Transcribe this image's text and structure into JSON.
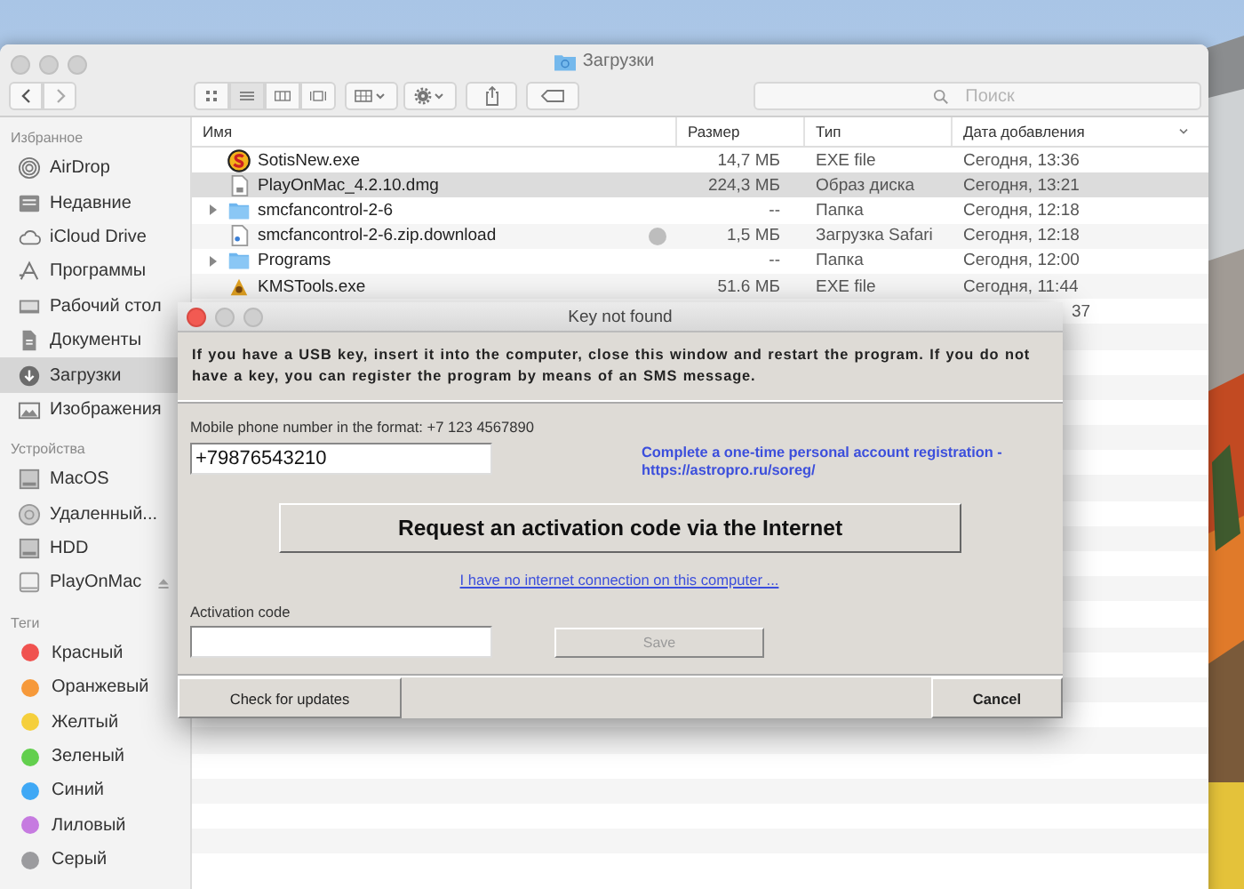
{
  "finder": {
    "title": "Загрузки",
    "search": {
      "placeholder": "Поиск"
    },
    "sidebar": [
      {
        "heading": "Избранное",
        "items": [
          {
            "label": "AirDrop",
            "selected": false
          },
          {
            "label": "Недавние",
            "selected": false
          },
          {
            "label": "iCloud Drive",
            "selected": false
          },
          {
            "label": "Программы",
            "selected": false
          },
          {
            "label": "Рабочий стол",
            "selected": false
          },
          {
            "label": "Документы",
            "selected": false
          },
          {
            "label": "Загрузки",
            "selected": true
          },
          {
            "label": "Изображения",
            "selected": false
          }
        ]
      },
      {
        "heading": "Устройства",
        "items": [
          {
            "label": "MacOS",
            "selected": false,
            "eject": false
          },
          {
            "label": "Удаленный...",
            "selected": false,
            "eject": false
          },
          {
            "label": "HDD",
            "selected": false,
            "eject": false
          },
          {
            "label": "PlayOnMac",
            "selected": false,
            "eject": true
          }
        ]
      }
    ],
    "tags_heading": "Теги",
    "tags": [
      {
        "label": "Красный",
        "color": "#f0524f"
      },
      {
        "label": "Оранжевый",
        "color": "#f6993a"
      },
      {
        "label": "Желтый",
        "color": "#f5cf3c"
      },
      {
        "label": "Зеленый",
        "color": "#62cf4d"
      },
      {
        "label": "Синий",
        "color": "#3fa8f5"
      },
      {
        "label": "Лиловый",
        "color": "#c67be0"
      },
      {
        "label": "Серый",
        "color": "#9b9b9e"
      }
    ],
    "columns": [
      "Имя",
      "Размер",
      "Тип",
      "Дата добавления"
    ],
    "files": [
      {
        "kind": "exe-s",
        "name": "SotisNew.exe",
        "size": "14,7 МБ",
        "type": "EXE file",
        "date": "Сегодня, 13:36",
        "selected": false
      },
      {
        "kind": "dmg",
        "name": "PlayOnMac_4.2.10.dmg",
        "size": "224,3 МБ",
        "type": "Образ диска",
        "date": "Сегодня, 13:21",
        "selected": true
      },
      {
        "kind": "folder",
        "name": "smcfancontrol-2-6",
        "size": "--",
        "type": "Папка",
        "date": "Сегодня, 12:18",
        "selected": false
      },
      {
        "kind": "download",
        "name": "smcfancontrol-2-6.zip.download",
        "size": "1,5 МБ",
        "type": "Загрузка Safari",
        "date": "Сегодня, 12:18",
        "selected": false
      },
      {
        "kind": "folder",
        "name": "Programs",
        "size": "--",
        "type": "Папка",
        "date": "Сегодня, 12:00",
        "selected": false
      },
      {
        "kind": "exe-k",
        "name": "KMSTools.exe",
        "size": "51.6 МБ",
        "type": "EXE file",
        "date": "Сегодня, 11:44",
        "selected": false
      },
      {
        "kind": "cut",
        "date": "37",
        "selected": false
      }
    ]
  },
  "dialog": {
    "title": "Key not found",
    "message": "If you have a USB key, insert it into the computer, close this window and restart the program. If you do not have a key, you can register the program by means of an SMS message.",
    "phone_label": "Mobile phone number in the format: +7 123 4567890",
    "phone_value": "+79876543210",
    "registration_link": "Complete a one-time personal account registration - https://astropro.ru/soreg/",
    "request_button": "Request an activation code via the Internet",
    "no_internet_link": "I have no internet connection on this computer ...",
    "activation_label": "Activation code",
    "save_button": {
      "label": "Save",
      "disabled": true
    },
    "check_updates_button": "Check for updates",
    "cancel_button": "Cancel"
  }
}
